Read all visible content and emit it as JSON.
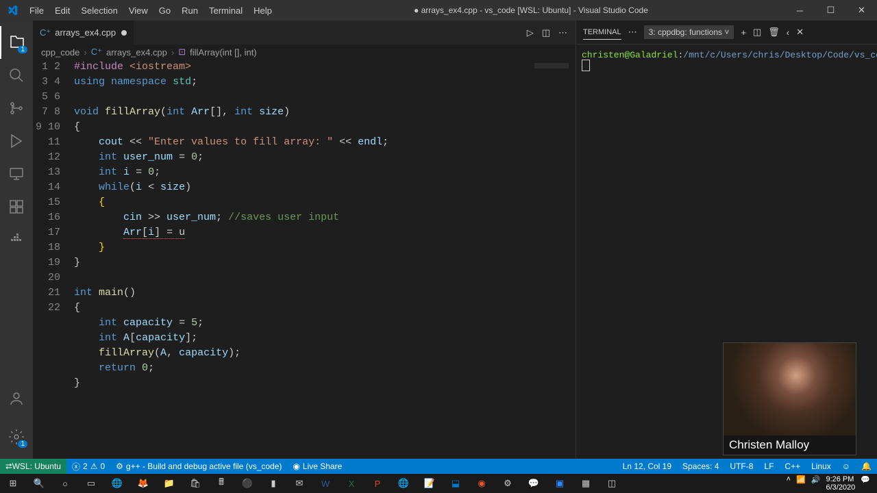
{
  "window": {
    "title": "● arrays_ex4.cpp - vs_code [WSL: Ubuntu] - Visual Studio Code"
  },
  "menu": [
    "File",
    "Edit",
    "Selection",
    "View",
    "Go",
    "Run",
    "Terminal",
    "Help"
  ],
  "tab": {
    "name": "arrays_ex4.cpp",
    "modified": true
  },
  "breadcrumb": {
    "folder": "cpp_code",
    "file": "arrays_ex4.cpp",
    "symbol": "fillArray(int [], int)"
  },
  "terminal": {
    "label": "TERMINAL",
    "select": "3: cppdbg: functions",
    "user": "christen",
    "host": "Galadriel",
    "path": "/mnt/c/Users/chris/Desktop/Code/vs_code/cpp_code",
    "prompt": "$"
  },
  "status": {
    "remote": "WSL: Ubuntu",
    "errors": "2",
    "warnings": "0",
    "build": "g++ - Build and debug active file (vs_code)",
    "live": "Live Share",
    "pos": "Ln 12, Col 19",
    "spaces": "Spaces: 4",
    "enc": "UTF-8",
    "eol": "LF",
    "lang": "C++",
    "os": "Linux",
    "feedback": "☺"
  },
  "camera": {
    "name": "Christen Malloy"
  },
  "clock": {
    "time": "9:26 PM",
    "date": "6/3/2020"
  },
  "code_lines": [
    1,
    2,
    3,
    4,
    5,
    6,
    7,
    8,
    9,
    10,
    11,
    12,
    13,
    14,
    15,
    16,
    17,
    18,
    19,
    20,
    21,
    22
  ]
}
